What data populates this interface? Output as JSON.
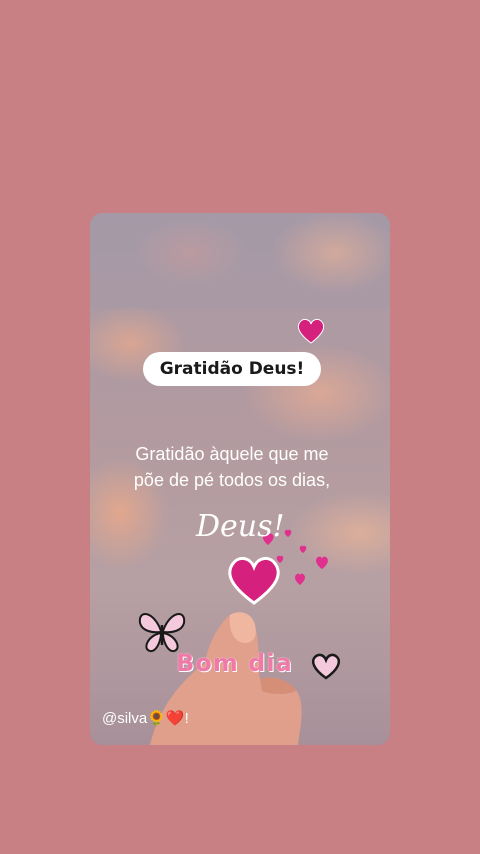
{
  "post": {
    "badge": "Gratidão Deus!",
    "quote_line1": "Gratidão àquele que me",
    "quote_line2": "põe de pé todos os dias,",
    "signature": "Deus!",
    "greeting": "Bom dia",
    "handle": "@silva🌻❤️!"
  },
  "decorations": {
    "icons": [
      "heart-icon",
      "butterfly-icon",
      "hand-icon",
      "sunflower-icon"
    ],
    "colors": {
      "background": "#c98085",
      "heart": "#d6207e",
      "greeting_text": "#ef7aa8"
    }
  }
}
